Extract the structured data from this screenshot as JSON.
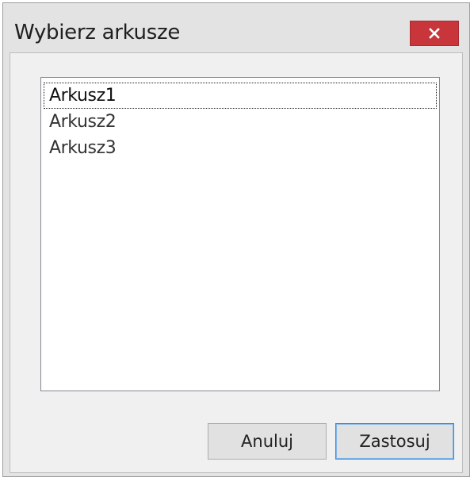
{
  "window": {
    "title": "Wybierz arkusze",
    "close_icon": "close-icon"
  },
  "sheets_list": {
    "items": [
      {
        "label": "Arkusz1",
        "focused": true
      },
      {
        "label": "Arkusz2",
        "focused": false
      },
      {
        "label": "Arkusz3",
        "focused": false
      }
    ]
  },
  "buttons": {
    "cancel_label": "Anuluj",
    "apply_label": "Zastosuj"
  },
  "colors": {
    "close_button_bg": "#c8353a",
    "dialog_bg": "#e3e3e3",
    "client_bg": "#f0f0f0",
    "default_button_border": "#3c8fd4"
  }
}
